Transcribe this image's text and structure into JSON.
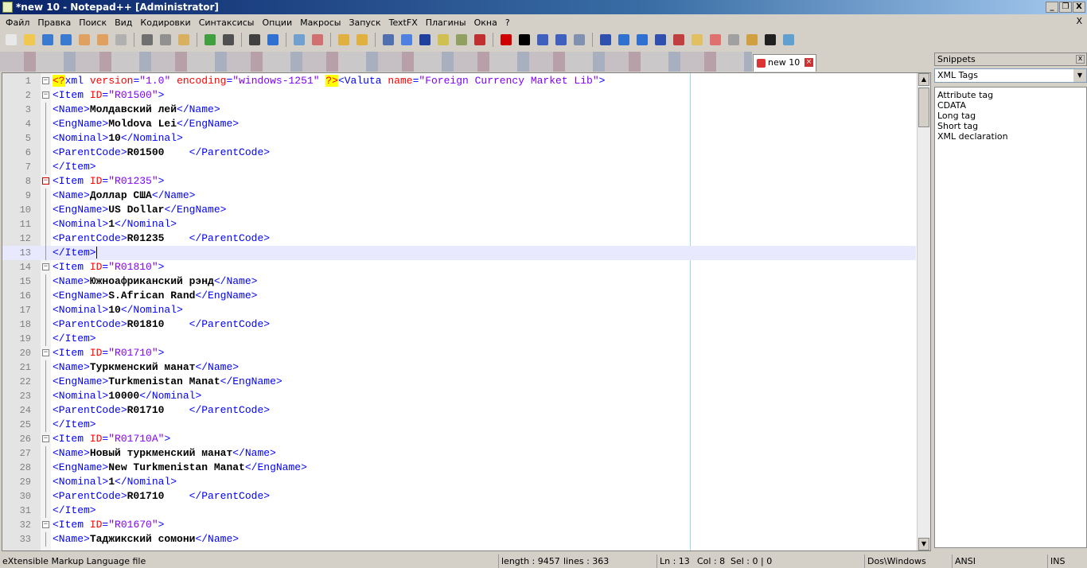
{
  "window": {
    "title": "*new  10 - Notepad++ [Administrator]",
    "controls": [
      "_",
      "❐",
      "X"
    ]
  },
  "menu": {
    "items": [
      "Файл",
      "Правка",
      "Поиск",
      "Вид",
      "Кодировки",
      "Синтаксисы",
      "Опции",
      "Макросы",
      "Запуск",
      "TextFX",
      "Плагины",
      "Окна",
      "?"
    ],
    "close": "X"
  },
  "toolbar": {
    "icons": [
      {
        "name": "new-file-icon",
        "color": "#e8e8e8"
      },
      {
        "name": "open-file-icon",
        "color": "#f0c850"
      },
      {
        "name": "save-icon",
        "color": "#3a7ad0"
      },
      {
        "name": "save-all-icon",
        "color": "#3a7ad0"
      },
      {
        "name": "close-icon",
        "color": "#e0a060"
      },
      {
        "name": "close-all-icon",
        "color": "#e0a060"
      },
      {
        "name": "print-icon",
        "color": "#b0b0b0"
      },
      {
        "sep": true
      },
      {
        "name": "cut-icon",
        "color": "#707070"
      },
      {
        "name": "copy-icon",
        "color": "#909090"
      },
      {
        "name": "paste-icon",
        "color": "#d8b060"
      },
      {
        "sep": true
      },
      {
        "name": "undo-icon",
        "color": "#40a040"
      },
      {
        "name": "redo-icon",
        "color": "#505050"
      },
      {
        "sep": true
      },
      {
        "name": "find-icon",
        "color": "#404040"
      },
      {
        "name": "replace-icon",
        "color": "#3070d0"
      },
      {
        "sep": true
      },
      {
        "name": "zoom-in-icon",
        "color": "#70a0d0"
      },
      {
        "name": "zoom-out-icon",
        "color": "#d07070"
      },
      {
        "sep": true
      },
      {
        "name": "sync-vertical-icon",
        "color": "#e0b040"
      },
      {
        "name": "sync-horizontal-icon",
        "color": "#e0b040"
      },
      {
        "sep": true
      },
      {
        "name": "word-wrap-icon",
        "color": "#5070b0"
      },
      {
        "name": "show-all-chars-icon",
        "color": "#5080e0"
      },
      {
        "name": "indent-guide-icon",
        "color": "#2040a0"
      },
      {
        "name": "user-lang-icon",
        "color": "#d0c050"
      },
      {
        "name": "doc-map-icon",
        "color": "#90a060"
      },
      {
        "name": "function-list-icon",
        "color": "#c03030"
      },
      {
        "sep": true
      },
      {
        "name": "record-macro-icon",
        "color": "#d00000"
      },
      {
        "name": "stop-macro-icon",
        "color": "#000000"
      },
      {
        "name": "play-macro-icon",
        "color": "#4060c0"
      },
      {
        "name": "play-multiple-icon",
        "color": "#4060c0"
      },
      {
        "name": "save-macro-icon",
        "color": "#8090b0"
      },
      {
        "sep": true
      },
      {
        "name": "sort-icon",
        "color": "#3050b0"
      },
      {
        "name": "up-arrow-icon",
        "color": "#3070d0"
      },
      {
        "name": "down-arrow-icon",
        "color": "#3070d0"
      },
      {
        "name": "sort-desc-icon",
        "color": "#3050b0"
      },
      {
        "name": "spell-check-icon",
        "color": "#c04040"
      },
      {
        "name": "notes-icon",
        "color": "#e0c060"
      },
      {
        "name": "eraser-icon",
        "color": "#e07070"
      },
      {
        "name": "clipboard-icon",
        "color": "#a0a0a0"
      },
      {
        "name": "folder-icon",
        "color": "#d0a040"
      },
      {
        "name": "snippets-icon",
        "color": "#202020"
      },
      {
        "name": "abc-check-icon",
        "color": "#60a0d0"
      }
    ]
  },
  "tab": {
    "label": "new  10"
  },
  "editor": {
    "lines": [
      [
        [
          "pi",
          "<?"
        ],
        [
          "tag",
          "xml "
        ],
        [
          "attr",
          "version"
        ],
        [
          "tag",
          "="
        ],
        [
          "val",
          "\"1.0\" "
        ],
        [
          "attr",
          "encoding"
        ],
        [
          "tag",
          "="
        ],
        [
          "val",
          "\"windows-1251\" "
        ],
        [
          "pi",
          "?>"
        ],
        [
          "tag",
          "<Valuta "
        ],
        [
          "attr",
          "name"
        ],
        [
          "tag",
          "="
        ],
        [
          "val",
          "\"Foreign Currency Market Lib\""
        ],
        [
          "tag",
          ">"
        ]
      ],
      [
        [
          "tag",
          "<Item "
        ],
        [
          "attr",
          "ID"
        ],
        [
          "tag",
          "="
        ],
        [
          "val",
          "\"R01500\""
        ],
        [
          "tag",
          ">"
        ]
      ],
      [
        [
          "tag",
          "<Name>"
        ],
        [
          "text",
          "Молдавский лей"
        ],
        [
          "tag",
          "</Name>"
        ]
      ],
      [
        [
          "tag",
          "<EngName>"
        ],
        [
          "text",
          "Moldova Lei"
        ],
        [
          "tag",
          "</EngName>"
        ]
      ],
      [
        [
          "tag",
          "<Nominal>"
        ],
        [
          "text",
          "10"
        ],
        [
          "tag",
          "</Nominal>"
        ]
      ],
      [
        [
          "tag",
          "<ParentCode>"
        ],
        [
          "text",
          "R01500    "
        ],
        [
          "tag",
          "</ParentCode>"
        ]
      ],
      [
        [
          "tag",
          "</Item>"
        ]
      ],
      [
        [
          "tag",
          "<Item "
        ],
        [
          "attr",
          "ID"
        ],
        [
          "tag",
          "="
        ],
        [
          "val",
          "\"R01235\""
        ],
        [
          "tag",
          ">"
        ]
      ],
      [
        [
          "tag",
          "<Name>"
        ],
        [
          "text",
          "Доллар США"
        ],
        [
          "tag",
          "</Name>"
        ]
      ],
      [
        [
          "tag",
          "<EngName>"
        ],
        [
          "text",
          "US Dollar"
        ],
        [
          "tag",
          "</EngName>"
        ]
      ],
      [
        [
          "tag",
          "<Nominal>"
        ],
        [
          "text",
          "1"
        ],
        [
          "tag",
          "</Nominal>"
        ]
      ],
      [
        [
          "tag",
          "<ParentCode>"
        ],
        [
          "text",
          "R01235    "
        ],
        [
          "tag",
          "</ParentCode>"
        ]
      ],
      [
        [
          "tag",
          "</Item>"
        ]
      ],
      [
        [
          "tag",
          "<Item "
        ],
        [
          "attr",
          "ID"
        ],
        [
          "tag",
          "="
        ],
        [
          "val",
          "\"R01810\""
        ],
        [
          "tag",
          ">"
        ]
      ],
      [
        [
          "tag",
          "<Name>"
        ],
        [
          "text",
          "Южноафриканский рэнд"
        ],
        [
          "tag",
          "</Name>"
        ]
      ],
      [
        [
          "tag",
          "<EngName>"
        ],
        [
          "text",
          "S.African Rand"
        ],
        [
          "tag",
          "</EngName>"
        ]
      ],
      [
        [
          "tag",
          "<Nominal>"
        ],
        [
          "text",
          "10"
        ],
        [
          "tag",
          "</Nominal>"
        ]
      ],
      [
        [
          "tag",
          "<ParentCode>"
        ],
        [
          "text",
          "R01810    "
        ],
        [
          "tag",
          "</ParentCode>"
        ]
      ],
      [
        [
          "tag",
          "</Item>"
        ]
      ],
      [
        [
          "tag",
          "<Item "
        ],
        [
          "attr",
          "ID"
        ],
        [
          "tag",
          "="
        ],
        [
          "val",
          "\"R01710\""
        ],
        [
          "tag",
          ">"
        ]
      ],
      [
        [
          "tag",
          "<Name>"
        ],
        [
          "text",
          "Туркменский манат"
        ],
        [
          "tag",
          "</Name>"
        ]
      ],
      [
        [
          "tag",
          "<EngName>"
        ],
        [
          "text",
          "Turkmenistan Manat"
        ],
        [
          "tag",
          "</EngName>"
        ]
      ],
      [
        [
          "tag",
          "<Nominal>"
        ],
        [
          "text",
          "10000"
        ],
        [
          "tag",
          "</Nominal>"
        ]
      ],
      [
        [
          "tag",
          "<ParentCode>"
        ],
        [
          "text",
          "R01710    "
        ],
        [
          "tag",
          "</ParentCode>"
        ]
      ],
      [
        [
          "tag",
          "</Item>"
        ]
      ],
      [
        [
          "tag",
          "<Item "
        ],
        [
          "attr",
          "ID"
        ],
        [
          "tag",
          "="
        ],
        [
          "val",
          "\"R01710A\""
        ],
        [
          "tag",
          ">"
        ]
      ],
      [
        [
          "tag",
          "<Name>"
        ],
        [
          "text",
          "Новый туркменский манат"
        ],
        [
          "tag",
          "</Name>"
        ]
      ],
      [
        [
          "tag",
          "<EngName>"
        ],
        [
          "text",
          "New Turkmenistan Manat"
        ],
        [
          "tag",
          "</EngName>"
        ]
      ],
      [
        [
          "tag",
          "<Nominal>"
        ],
        [
          "text",
          "1"
        ],
        [
          "tag",
          "</Nominal>"
        ]
      ],
      [
        [
          "tag",
          "<ParentCode>"
        ],
        [
          "text",
          "R01710    "
        ],
        [
          "tag",
          "</ParentCode>"
        ]
      ],
      [
        [
          "tag",
          "</Item>"
        ]
      ],
      [
        [
          "tag",
          "<Item "
        ],
        [
          "attr",
          "ID"
        ],
        [
          "tag",
          "="
        ],
        [
          "val",
          "\"R01670\""
        ],
        [
          "tag",
          ">"
        ]
      ],
      [
        [
          "tag",
          "<Name>"
        ],
        [
          "text",
          "Таджикский сомони"
        ],
        [
          "tag",
          "</Name>"
        ]
      ]
    ],
    "current_line": 13,
    "fold_lines": [
      1,
      2,
      8,
      14,
      20,
      26,
      32
    ]
  },
  "snippets": {
    "title": "Snippets",
    "close": "x",
    "selected": "XML Tags",
    "items": [
      "Attribute tag",
      "CDATA",
      "Long tag",
      "Short tag",
      "XML declaration"
    ]
  },
  "status": {
    "file_type": "eXtensible Markup Language file",
    "length": "length : 9457",
    "lines": "lines : 363",
    "ln": "Ln : 13",
    "col": "Col : 8",
    "sel": "Sel : 0 | 0",
    "eol": "Dos\\Windows",
    "encoding": "ANSI",
    "mode": "INS"
  }
}
